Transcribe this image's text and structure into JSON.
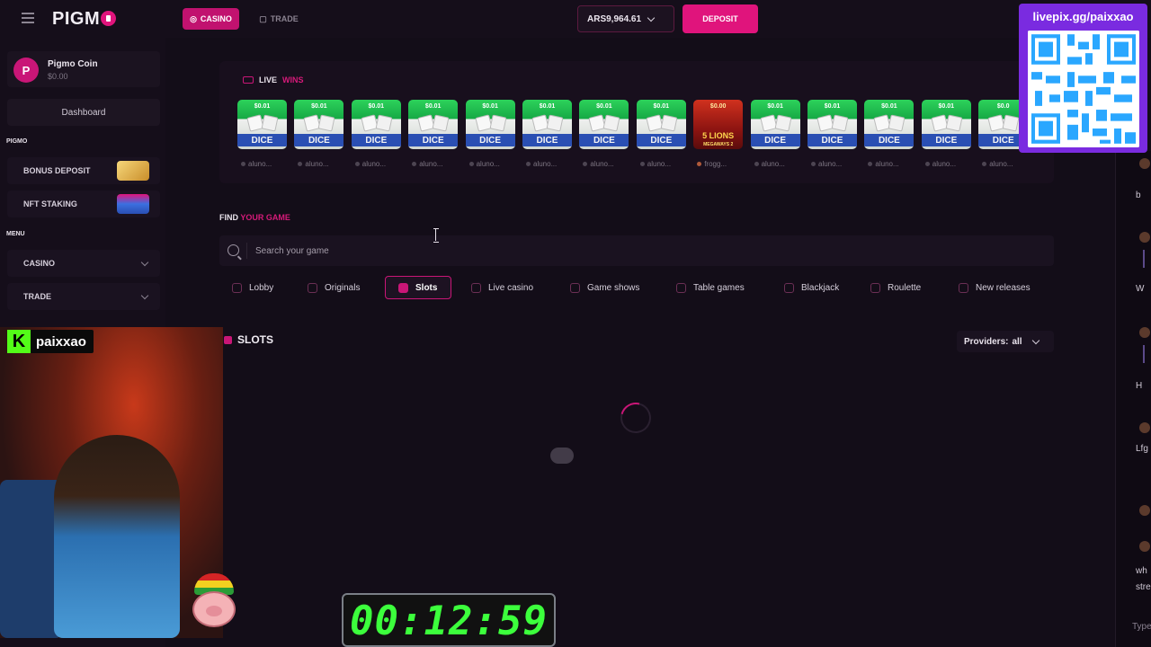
{
  "header": {
    "logo": "PIGM",
    "tabs": [
      {
        "label": "CASINO",
        "icon": "casino-icon",
        "active": true
      },
      {
        "label": "TRADE",
        "icon": "trade-icon",
        "active": false
      }
    ],
    "balance": "ARS9,964.61",
    "deposit_label": "DEPOSIT"
  },
  "sidebar": {
    "coin": {
      "badge": "P",
      "name": "Pigmo Coin",
      "value": "$0.00"
    },
    "dashboard": "Dashboard",
    "section_pigmo": "PIGMO",
    "pigmo_items": [
      {
        "label": "BONUS DEPOSIT",
        "icon": "gift-box-icon"
      },
      {
        "label": "NFT STAKING",
        "icon": "treasure-chest-icon"
      }
    ],
    "section_menu": "MENU",
    "menu_items": [
      {
        "label": "CASINO"
      },
      {
        "label": "TRADE"
      }
    ]
  },
  "live_wins": {
    "title_a": "LIVE",
    "title_b": "WINS",
    "tiles": [
      {
        "game": "DICE",
        "amount": "$0.01",
        "player": "aluno..."
      },
      {
        "game": "DICE",
        "amount": "$0.01",
        "player": "aluno..."
      },
      {
        "game": "DICE",
        "amount": "$0.01",
        "player": "aluno..."
      },
      {
        "game": "DICE",
        "amount": "$0.01",
        "player": "aluno..."
      },
      {
        "game": "DICE",
        "amount": "$0.01",
        "player": "aluno..."
      },
      {
        "game": "DICE",
        "amount": "$0.01",
        "player": "aluno..."
      },
      {
        "game": "DICE",
        "amount": "$0.01",
        "player": "aluno..."
      },
      {
        "game": "DICE",
        "amount": "$0.01",
        "player": "aluno..."
      },
      {
        "game": "5 LIONS",
        "game_sub": "MEGAWAYS 2",
        "amount": "$0.00",
        "player": "frogg..."
      },
      {
        "game": "DICE",
        "amount": "$0.01",
        "player": "aluno..."
      },
      {
        "game": "DICE",
        "amount": "$0.01",
        "player": "aluno..."
      },
      {
        "game": "DICE",
        "amount": "$0.01",
        "player": "aluno..."
      },
      {
        "game": "DICE",
        "amount": "$0.01",
        "player": "aluno..."
      },
      {
        "game": "DICE",
        "amount": "$0.0",
        "player": "aluno..."
      }
    ]
  },
  "find": {
    "title_a": "FIND",
    "title_b": "YOUR GAME",
    "search_placeholder": "Search your game"
  },
  "categories": [
    {
      "label": "Lobby",
      "icon": "lobby-icon"
    },
    {
      "label": "Originals",
      "icon": "originals-icon"
    },
    {
      "label": "Slots",
      "icon": "slots-icon",
      "active": true
    },
    {
      "label": "Live casino",
      "icon": "live-casino-icon"
    },
    {
      "label": "Game shows",
      "icon": "game-shows-icon"
    },
    {
      "label": "Table games",
      "icon": "table-games-icon"
    },
    {
      "label": "Blackjack",
      "icon": "blackjack-icon"
    },
    {
      "label": "Roulette",
      "icon": "roulette-icon"
    },
    {
      "label": "New releases",
      "icon": "new-releases-icon"
    }
  ],
  "slots": {
    "title": "SLOTS",
    "providers_label": "Providers:",
    "providers_value": "all"
  },
  "overlays": {
    "qr_label": "livepix.gg/paixxao",
    "streamer": "paixxao",
    "kick_letter": "K",
    "timer": "00:12:59"
  },
  "chat": {
    "fragments": [
      "b",
      "W",
      "H",
      "Lfg",
      "wh",
      "stre"
    ],
    "input_placeholder": "Type"
  },
  "colors": {
    "accent": "#e0147c",
    "background": "#130d18",
    "panel": "#1a1220"
  }
}
